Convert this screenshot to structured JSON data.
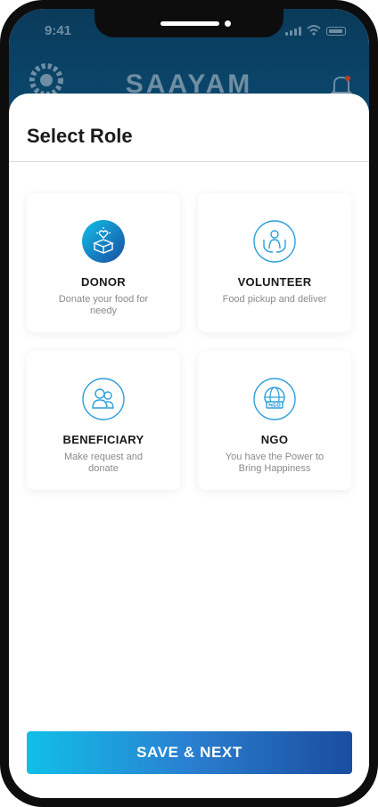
{
  "status_bar": {
    "time": "9:41"
  },
  "header": {
    "app_title": "SAAYAM"
  },
  "sheet": {
    "title": "Select Role",
    "roles": [
      {
        "label": "DONOR",
        "description": "Donate your food for needy",
        "icon": "donation-box-icon",
        "selected": true
      },
      {
        "label": "VOLUNTEER",
        "description": "Food pickup and deliver",
        "icon": "hands-person-icon",
        "selected": false
      },
      {
        "label": "BENEFICIARY",
        "description": "Make request and donate",
        "icon": "people-icon",
        "selected": false
      },
      {
        "label": "NGO",
        "description": "You have the Power to Bring Happiness",
        "icon": "globe-ngo-icon",
        "selected": false
      }
    ]
  },
  "footer": {
    "save_next_label": "SAVE & NEXT"
  },
  "colors": {
    "accent_start": "#11bfe8",
    "accent_end": "#1a4da0",
    "header_bg": "#0b4d74",
    "icon_stroke": "#2b9fd8"
  }
}
